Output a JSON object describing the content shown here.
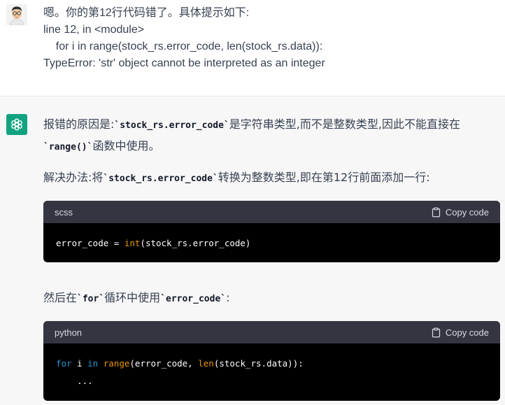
{
  "user": {
    "lines": [
      "嗯。你的第12行代码错了。具体提示如下:",
      "line 12, in <module>",
      "    for i in range(stock_rs.error_code, len(stock_rs.data)):",
      "TypeError: 'str' object cannot be interpreted as an integer"
    ]
  },
  "assistant": {
    "p1": {
      "a": "报错的原因是:",
      "code1": "`stock_rs.error_code`",
      "b": "是字符串类型,而不是整数类型,因此不能直接在",
      "code2": "`range()`",
      "c": "函数中使用。"
    },
    "p2": {
      "a": "解决办法:将",
      "code1": "`stock_rs.error_code`",
      "b": "转换为整数类型,即在第12行前面添加一行:"
    },
    "p3": {
      "a": "然后在",
      "code1": "`for`",
      "b": "循环中使用",
      "code2": "`error_code`",
      "c": ":"
    },
    "code1": {
      "lang": "scss",
      "copy_label": "Copy code",
      "lines": [
        {
          "tokens": [
            {
              "t": "error_code = ",
              "c": ""
            },
            {
              "t": "int",
              "c": "fn"
            },
            {
              "t": "(stock_rs.error_code)",
              "c": ""
            }
          ]
        }
      ]
    },
    "code2": {
      "lang": "python",
      "copy_label": "Copy code",
      "lines": [
        {
          "tokens": [
            {
              "t": "for",
              "c": "kw"
            },
            {
              "t": " i ",
              "c": ""
            },
            {
              "t": "in",
              "c": "kw"
            },
            {
              "t": " ",
              "c": ""
            },
            {
              "t": "range",
              "c": "fn"
            },
            {
              "t": "(error_code, ",
              "c": ""
            },
            {
              "t": "len",
              "c": "fn"
            },
            {
              "t": "(stock_rs.data)):",
              "c": ""
            }
          ]
        },
        {
          "tokens": [
            {
              "t": "    ...",
              "c": ""
            }
          ]
        }
      ]
    }
  },
  "colors": {
    "assistant_avatar": "#10a37f",
    "code_header": "#343541",
    "code_bg": "#000000",
    "keyword": "#2e95d3",
    "function": "#e9950c"
  },
  "icons": {
    "user_avatar": "user-avatar",
    "assistant_avatar": "openai-logo-icon",
    "copy": "clipboard-icon"
  }
}
